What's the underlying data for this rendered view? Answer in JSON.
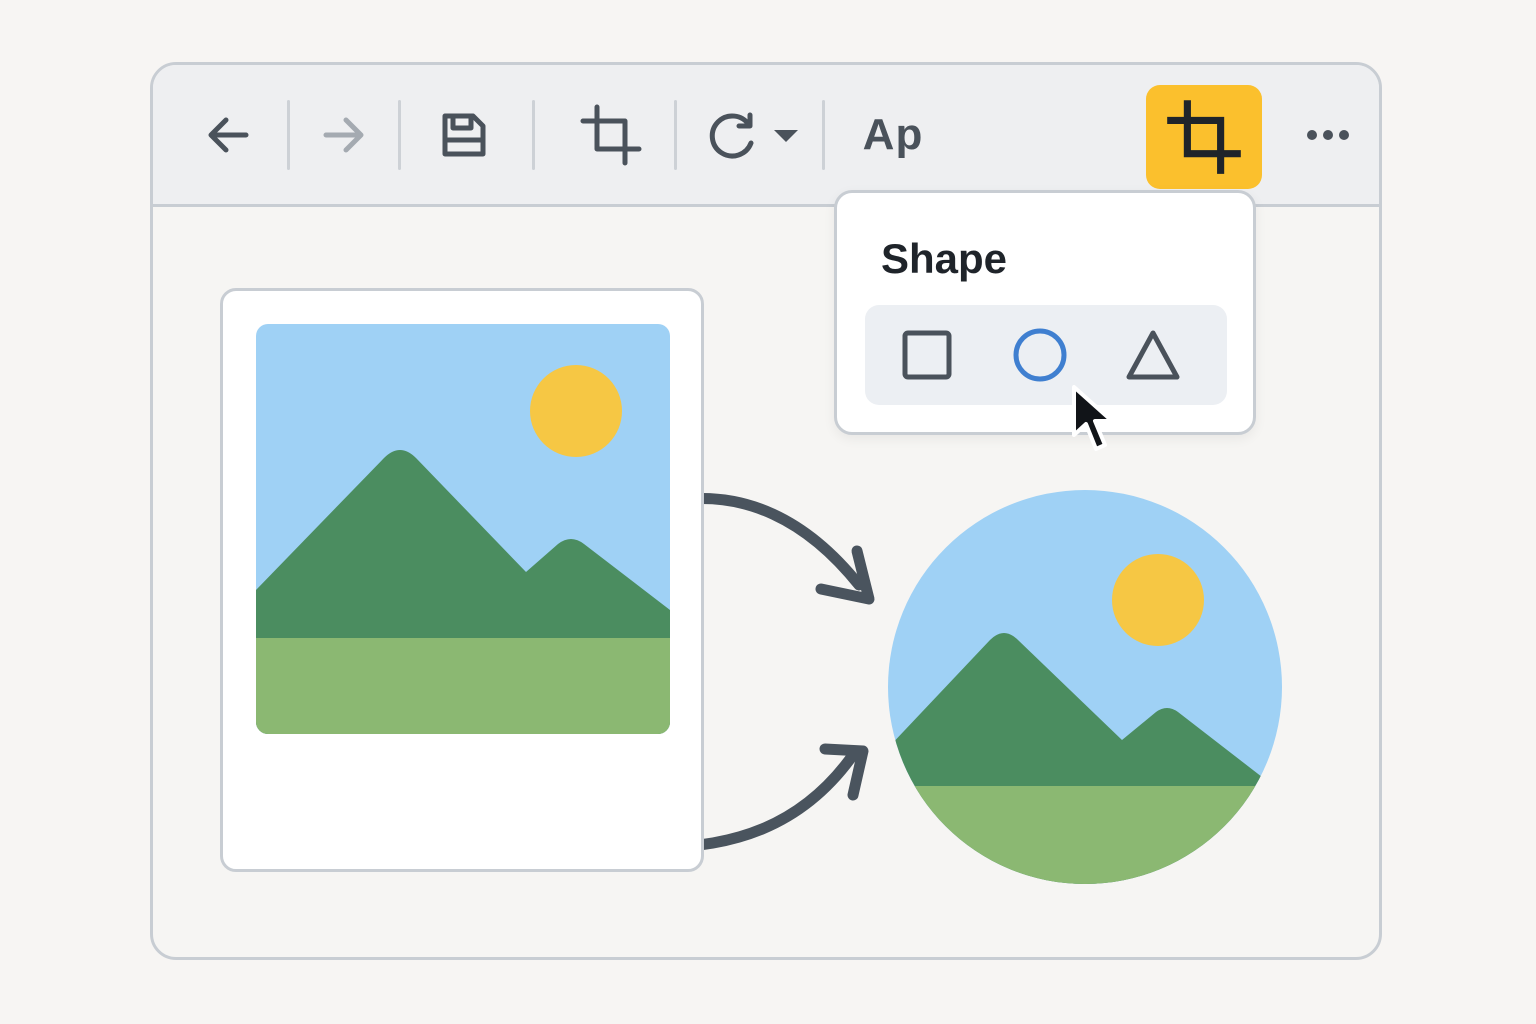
{
  "toolbar": {
    "back": {
      "icon": "arrow-left-icon"
    },
    "forward": {
      "icon": "arrow-right-icon",
      "state": "disabled"
    },
    "save": {
      "icon": "save-icon"
    },
    "crop": {
      "icon": "crop-icon"
    },
    "rotate": {
      "icon": "rotate-icon",
      "has_dropdown": true
    },
    "text_style_label": "Ap",
    "crop_shape": {
      "icon": "crop-icon",
      "state": "active"
    },
    "more": {
      "icon": "more-horizontal-icon"
    }
  },
  "shape_menu": {
    "title": "Shape",
    "options": [
      {
        "name": "square",
        "icon": "square-icon"
      },
      {
        "name": "circle",
        "icon": "circle-icon",
        "state": "hovered"
      },
      {
        "name": "triangle",
        "icon": "triangle-icon"
      }
    ]
  },
  "canvas": {
    "source": {
      "kind": "photo-card",
      "icon": "landscape-image"
    },
    "result": {
      "kind": "circle-cropped-image",
      "icon": "landscape-image"
    }
  },
  "colors": {
    "accent": "#fbc02d",
    "sky": "#9fd1f5",
    "sun": "#f6c744",
    "mountain": "#4b8d60",
    "grass": "#8bb872",
    "icon": "#4a525b",
    "selected_outline": "#3f7fd0",
    "arrow": "#4a545e"
  }
}
